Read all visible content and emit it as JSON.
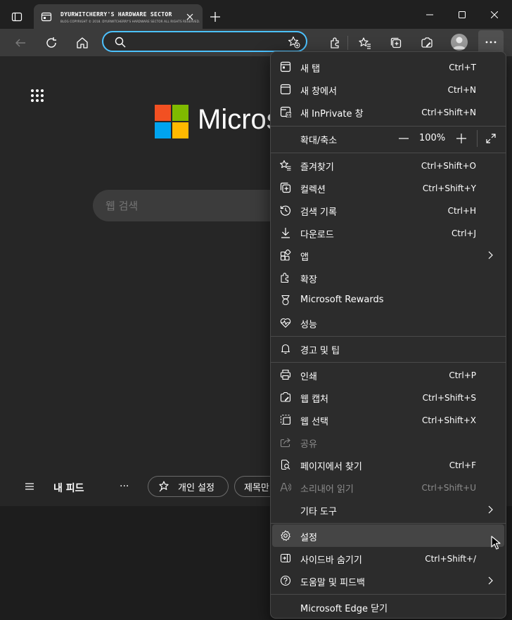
{
  "tab": {
    "title": "DYURWITCHERRY'S HARDWARE SECTOR",
    "subtitle": "BLOG COPYRIGHT © 2018. DYURWITCHERRY'S HARDWARE SECTOR ALL RIGHTS RESERVED."
  },
  "address_bar": {
    "value": "",
    "placeholder": ""
  },
  "newtab": {
    "brand": "Microsoft",
    "search_placeholder": "웹 검색",
    "feed_title": "내 피드",
    "feed_more": "···",
    "personalize": "개인 설정",
    "headlines": "제목만"
  },
  "menu": {
    "new_tab": {
      "label": "새 탭",
      "shortcut": "Ctrl+T"
    },
    "new_window": {
      "label": "새 창에서",
      "shortcut": "Ctrl+N"
    },
    "inprivate": {
      "label": "새 InPrivate 창",
      "shortcut": "Ctrl+Shift+N"
    },
    "zoom": {
      "label": "확대/축소",
      "value": "100%",
      "minus": "—",
      "plus": "+"
    },
    "favorites": {
      "label": "즐겨찾기",
      "shortcut": "Ctrl+Shift+O"
    },
    "collections": {
      "label": "컬렉션",
      "shortcut": "Ctrl+Shift+Y"
    },
    "history": {
      "label": "검색 기록",
      "shortcut": "Ctrl+H"
    },
    "downloads": {
      "label": "다운로드",
      "shortcut": "Ctrl+J"
    },
    "apps": {
      "label": "앱"
    },
    "extensions": {
      "label": "확장"
    },
    "rewards": {
      "label": "Microsoft Rewards"
    },
    "performance": {
      "label": "성능"
    },
    "alerts": {
      "label": "경고 및 팁"
    },
    "print": {
      "label": "인쇄",
      "shortcut": "Ctrl+P"
    },
    "web_capture": {
      "label": "웹 캡처",
      "shortcut": "Ctrl+Shift+S"
    },
    "web_select": {
      "label": "웹 선택",
      "shortcut": "Ctrl+Shift+X"
    },
    "share": {
      "label": "공유"
    },
    "find": {
      "label": "페이지에서 찾기",
      "shortcut": "Ctrl+F"
    },
    "read_aloud": {
      "label": "소리내어 읽기",
      "shortcut": "Ctrl+Shift+U"
    },
    "more_tools": {
      "label": "기타 도구"
    },
    "settings": {
      "label": "설정"
    },
    "hide_sidebar": {
      "label": "사이드바 숨기기",
      "shortcut": "Ctrl+Shift+/"
    },
    "help": {
      "label": "도움말 및 피드백"
    },
    "close_edge": {
      "label": "Microsoft Edge 닫기"
    }
  },
  "colors": {
    "accent": "#4cc2ff",
    "ms_red": "#f25022",
    "ms_green": "#7fba00",
    "ms_blue": "#00a4ef",
    "ms_yellow": "#ffb900"
  }
}
